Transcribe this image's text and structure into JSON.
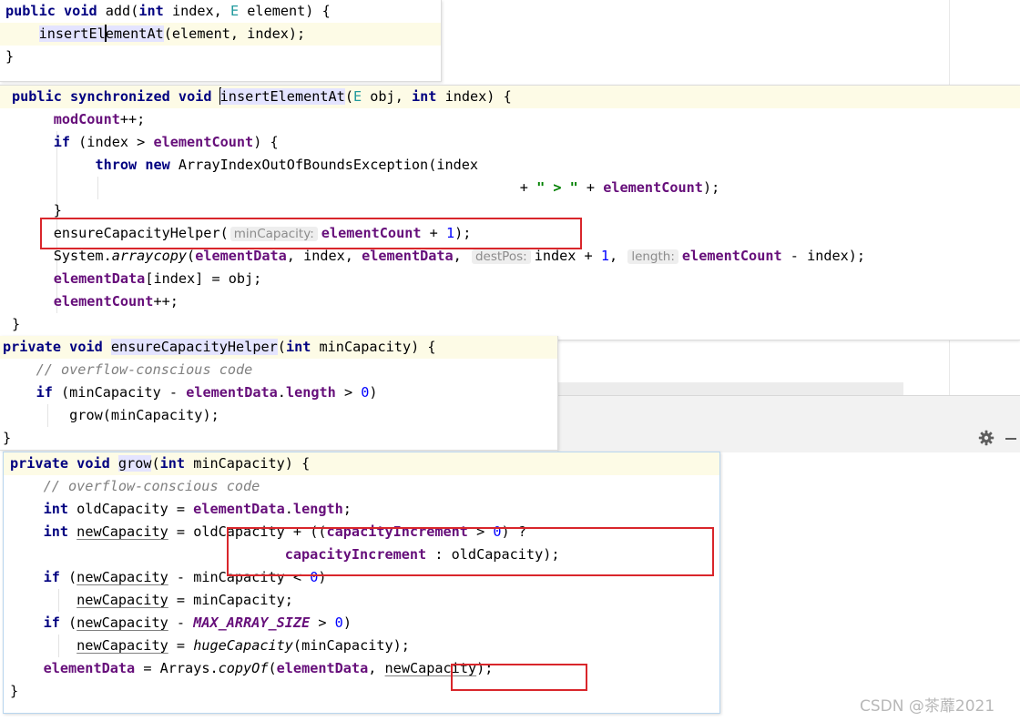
{
  "watermark": "CSDN @茶蘼2021",
  "icons": {
    "settings": "gear-icon",
    "hide": "minimize-icon"
  },
  "colors": {
    "keyword": "#000080",
    "field": "#660e7a",
    "number": "#0000ff",
    "string": "#008000",
    "comment": "#808080",
    "highlight_box": "#d9262b"
  },
  "snippet_add": {
    "sig_kw1": "public",
    "sig_kw2": "void",
    "sig_name": "add(",
    "sig_kw3": "int",
    "sig_a": "index,",
    "sig_type": "E",
    "sig_b": "element) {",
    "call_a": "insertEl",
    "call_b": "ementAt",
    "call_c": "(element, index);",
    "close": "}"
  },
  "snippet_insert": {
    "kw1": "public",
    "kw2": "synchronized",
    "kw3": "void",
    "name": "insertElementAt",
    "p1": "(",
    "type": "E",
    "p2": " obj, ",
    "kw4": "int",
    "p3": " index) {",
    "l1_fld": "modCount",
    "l1_rest": "++;",
    "l2_kw": "if",
    "l2_a": " (index > ",
    "l2_fld": "elementCount",
    "l2_b": ") {",
    "l3_kw1": "throw",
    "l3_kw2": "new",
    "l3_rest": " ArrayIndexOutOfBoundsException(index",
    "l4_a": "+ ",
    "l4_str": "\" > \"",
    "l4_b": " + ",
    "l4_fld": "elementCount",
    "l4_c": ");",
    "l5": "}",
    "l6_call": "ensureCapacityHelper(",
    "l6_hint": "minCapacity:",
    "l6_fld": "elementCount",
    "l6_a": " + ",
    "l6_num": "1",
    "l6_b": ");",
    "l7_a": "System.",
    "l7_m": "arraycopy",
    "l7_b": "(",
    "l7_fld1": "elementData",
    "l7_c": ", index, ",
    "l7_fld2": "elementData",
    "l7_d": ",",
    "l7_hint1": "destPos:",
    "l7_e": "index + ",
    "l7_num": "1",
    "l7_f": ",",
    "l7_hint2": "length:",
    "l7_fld3": "elementCount",
    "l7_g": " - index);",
    "l8_fld": "elementData",
    "l8_rest": "[index] = obj;",
    "l9_fld": "elementCount",
    "l9_rest": "++;",
    "close": "}"
  },
  "snippet_ensure": {
    "kw1": "private",
    "kw2": "void",
    "name": "ensureCapacityHelper",
    "p1": "(",
    "kw3": "int",
    "p2": " minCapacity) {",
    "cmt": "// overflow-conscious code",
    "if_kw": "if",
    "if_a": " (minCapacity - ",
    "if_fld": "elementData",
    "if_b": ".",
    "if_fld2": "length",
    "if_c": " > ",
    "if_num": "0",
    "if_d": ")",
    "grow": "grow(minCapacity);",
    "close": "}"
  },
  "snippet_grow": {
    "kw1": "private",
    "kw2": "void",
    "name": "grow",
    "p1": "(",
    "kw3": "int",
    "p2": " minCapacity) {",
    "cmt": "// overflow-conscious code",
    "l2_kw": "int",
    "l2_a": " oldCapacity = ",
    "l2_fld": "elementData",
    "l2_b": ".",
    "l2_fld2": "length",
    "l2_c": ";",
    "l3_kw": "int",
    "l3_var": "newCapacity",
    "l3_a": " = oldCapacity + ((",
    "l3_fld": "capacityIncrement",
    "l3_b": " > ",
    "l3_num": "0",
    "l3_c": ") ?",
    "l4_fld": "capacityIncrement",
    "l4_a": " : oldCapacity);",
    "l5_kw": "if",
    "l5_a": " (",
    "l5_var": "newCapacity",
    "l5_b": " - minCapacity < ",
    "l5_num": "0",
    "l5_c": ")",
    "l6_var": "newCapacity",
    "l6_a": " = minCapacity;",
    "l7_kw": "if",
    "l7_a": " (",
    "l7_var": "newCapacity",
    "l7_b": " - ",
    "l7_const": "MAX_ARRAY_SIZE",
    "l7_c": " > ",
    "l7_num": "0",
    "l7_d": ")",
    "l8_var": "newCapacity",
    "l8_a": " = ",
    "l8_m": "hugeCapacity",
    "l8_b": "(minCapacity);",
    "l9_fld": "elementData",
    "l9_a": " = Arrays.",
    "l9_m": "copyOf",
    "l9_b": "(",
    "l9_fld2": "elementData",
    "l9_c": ", ",
    "l9_var": "newCapacity",
    "l9_d": ");",
    "close": "}"
  }
}
